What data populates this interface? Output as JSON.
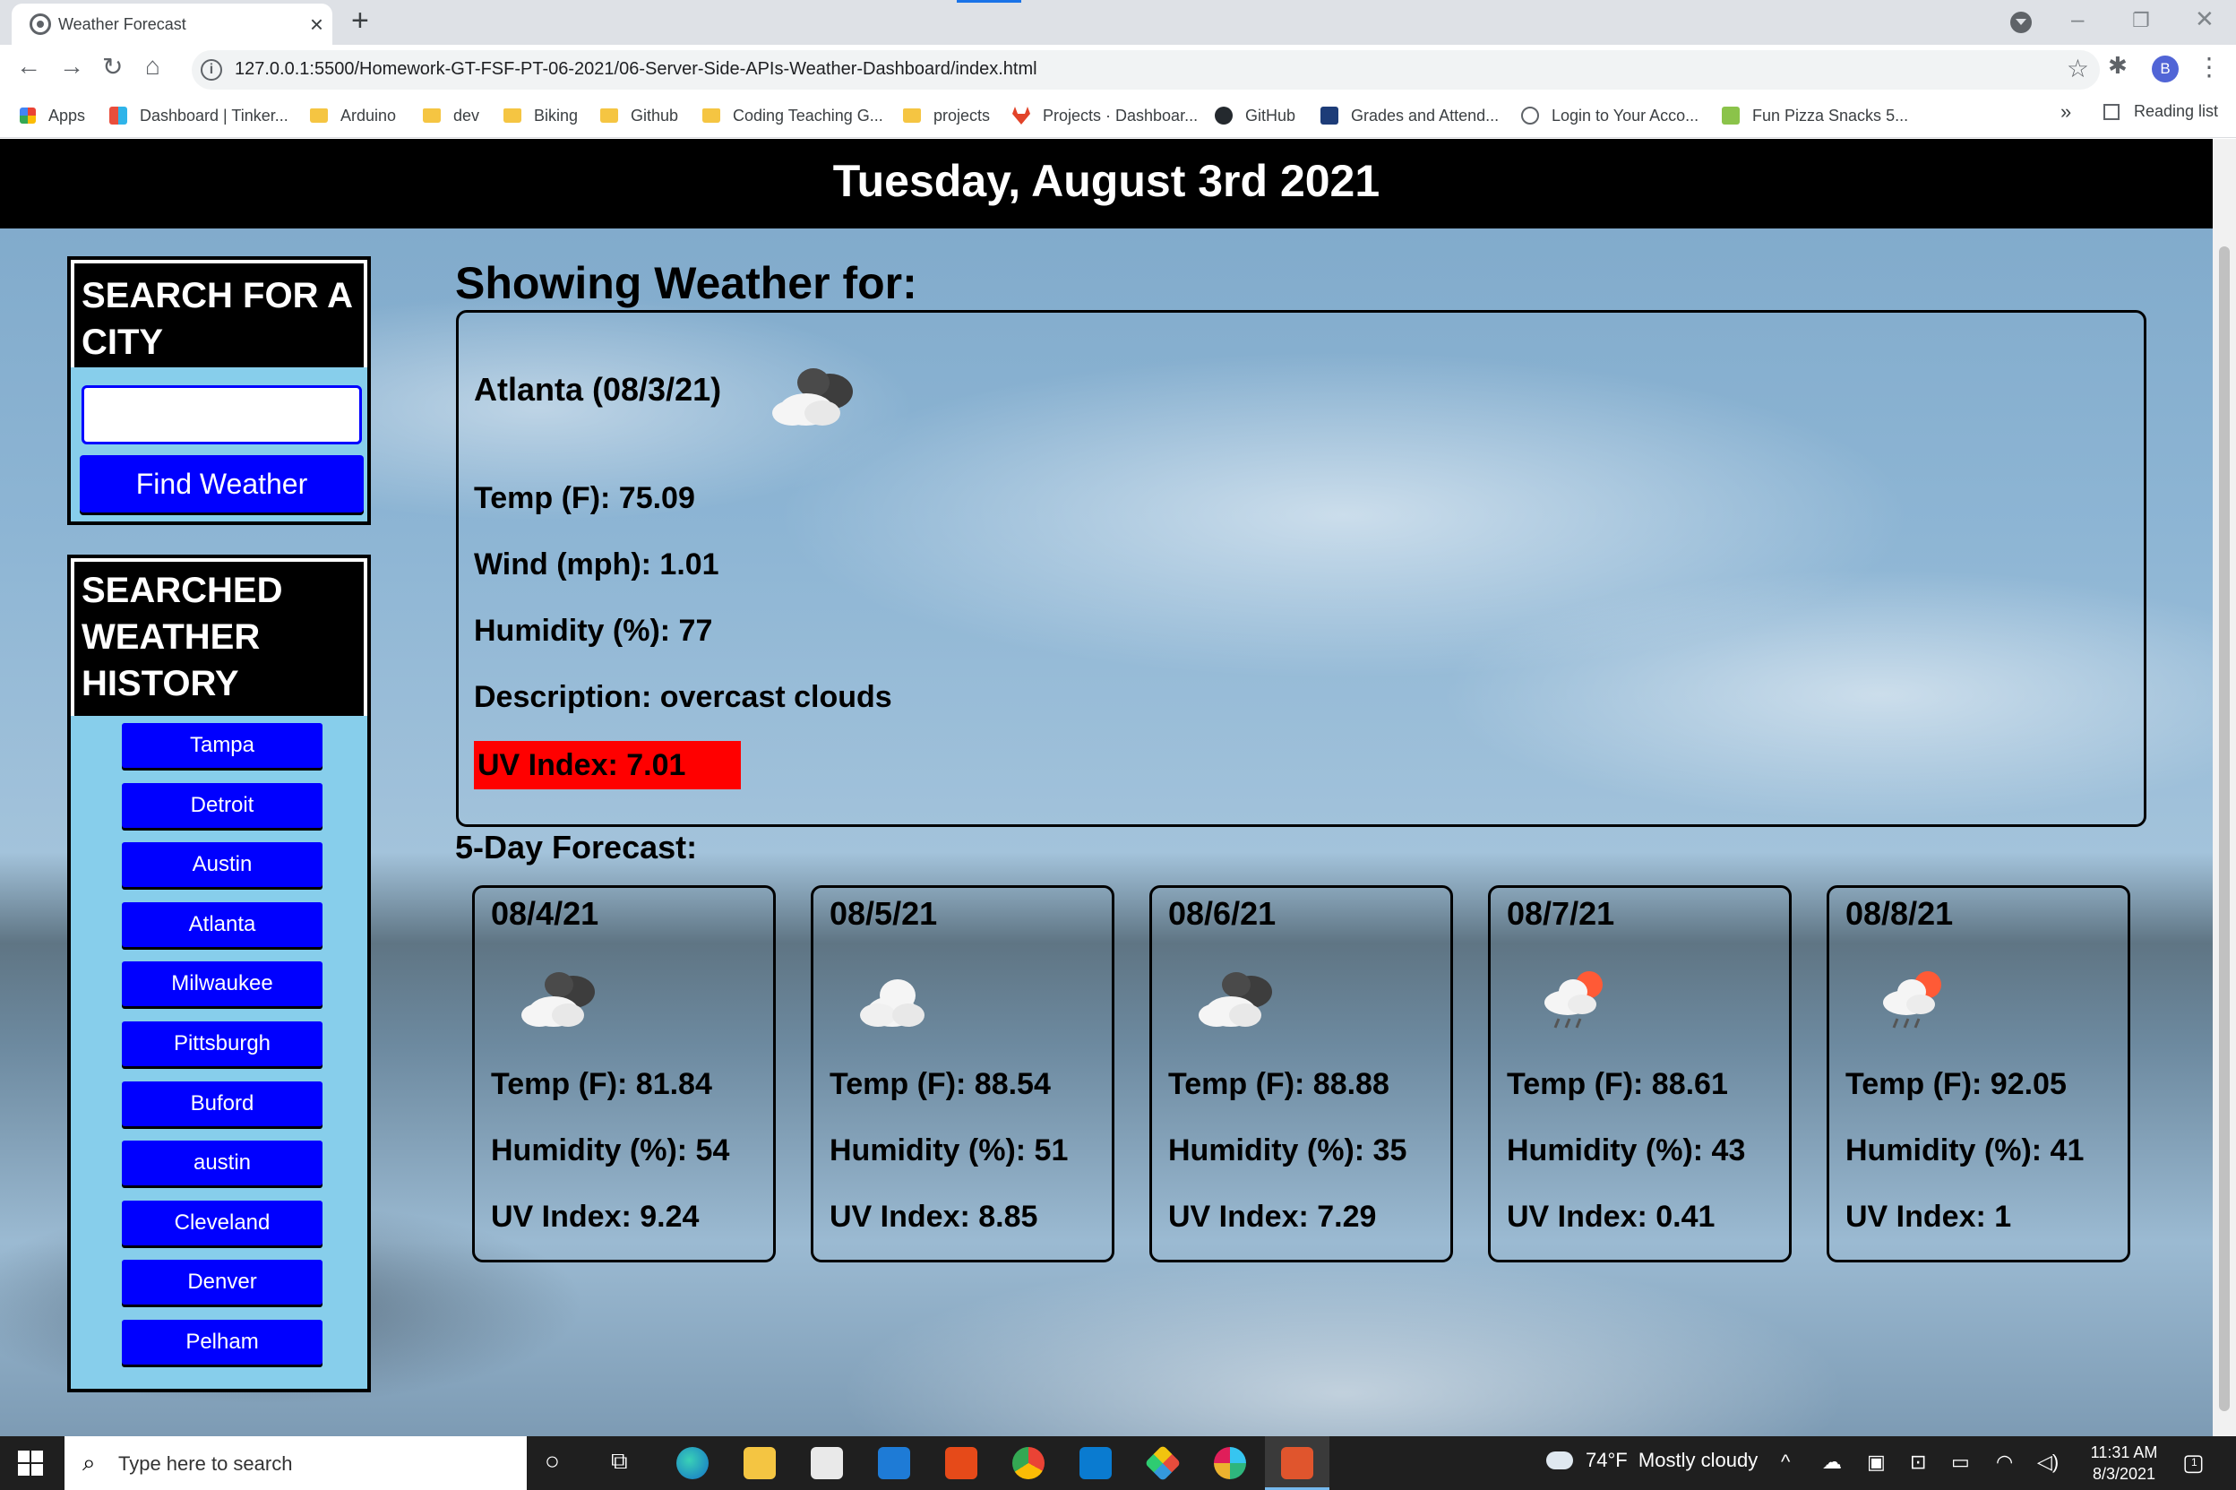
{
  "browser": {
    "tab_title": "Weather Forecast",
    "url": "127.0.0.1:5500/Homework-GT-FSF-PT-06-2021/06-Server-Side-APIs-Weather-Dashboard/index.html",
    "profile_initial": "B",
    "bookmarks": [
      {
        "label": "Apps"
      },
      {
        "label": "Dashboard | Tinker..."
      },
      {
        "label": "Arduino"
      },
      {
        "label": "dev"
      },
      {
        "label": "Biking"
      },
      {
        "label": "Github"
      },
      {
        "label": "Coding Teaching G..."
      },
      {
        "label": "projects"
      },
      {
        "label": "Projects · Dashboar..."
      },
      {
        "label": "GitHub"
      },
      {
        "label": "Grades and Attend..."
      },
      {
        "label": "Login to Your Acco..."
      },
      {
        "label": "Fun Pizza Snacks 5..."
      }
    ],
    "reading_list": "Reading list"
  },
  "page": {
    "date": "Tuesday, August 3rd 2021",
    "search": {
      "heading": "SEARCH FOR A CITY",
      "input_value": "",
      "button": "Find Weather"
    },
    "history": {
      "heading": "SEARCHED WEATHER HISTORY",
      "cities": [
        "Tampa",
        "Detroit",
        "Austin",
        "Atlanta",
        "Milwaukee",
        "Pittsburgh",
        "Buford",
        "austin",
        "Cleveland",
        "Denver",
        "Pelham"
      ]
    },
    "current": {
      "heading": "Showing Weather for:",
      "city_date": "Atlanta (08/3/21)",
      "icon": "overcast-clouds-icon",
      "temp": "Temp (F): 75.09",
      "wind": "Wind (mph): 1.01",
      "humidity": "Humidity (%): 77",
      "description": "Description: overcast clouds",
      "uv": "UV Index: 7.01",
      "uv_color": "#ff0000"
    },
    "forecast": {
      "heading": "5-Day Forecast:",
      "days": [
        {
          "date": "08/4/21",
          "icon": "broken-clouds-icon",
          "temp": "Temp (F): 81.84",
          "humidity": "Humidity (%): 54",
          "uv": "UV Index: 9.24"
        },
        {
          "date": "08/5/21",
          "icon": "cloud-icon",
          "temp": "Temp (F): 88.54",
          "humidity": "Humidity (%): 51",
          "uv": "UV Index: 8.85"
        },
        {
          "date": "08/6/21",
          "icon": "broken-clouds-icon",
          "temp": "Temp (F): 88.88",
          "humidity": "Humidity (%): 35",
          "uv": "UV Index: 7.29"
        },
        {
          "date": "08/7/21",
          "icon": "rain-sun-icon",
          "temp": "Temp (F): 88.61",
          "humidity": "Humidity (%): 43",
          "uv": "UV Index: 0.41"
        },
        {
          "date": "08/8/21",
          "icon": "rain-sun-icon",
          "temp": "Temp (F): 92.05",
          "humidity": "Humidity (%): 41",
          "uv": "UV Index: 1"
        }
      ]
    }
  },
  "taskbar": {
    "search_placeholder": "Type here to search",
    "weather": "74°F  Mostly cloudy",
    "time": "11:31 AM",
    "date": "8/3/2021",
    "notification_count": "1"
  },
  "colors": {
    "button_blue": "#0000ff",
    "panel_bg": "#87ceeb",
    "header_bg": "#000000"
  }
}
